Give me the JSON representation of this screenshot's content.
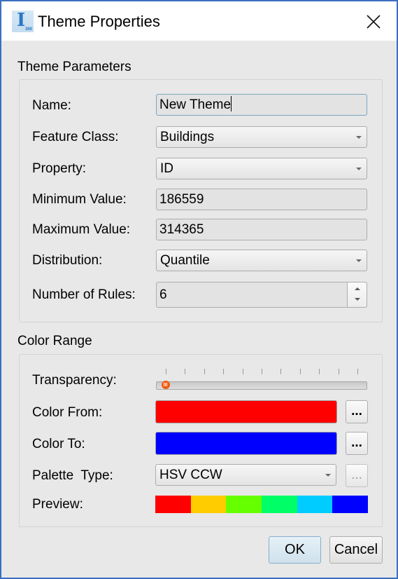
{
  "window": {
    "title": "Theme Properties",
    "app_icon": "app-logo-icon",
    "app_icon_letter": "I",
    "app_icon_sub": "360",
    "close_icon": "close-icon"
  },
  "theme_parameters": {
    "group_label": "Theme Parameters",
    "name": {
      "label": "Name:",
      "value": "New Theme"
    },
    "feature_class": {
      "label": "Feature Class:",
      "value": "Buildings"
    },
    "property": {
      "label": "Property:",
      "value": "ID"
    },
    "minimum_value": {
      "label": "Minimum Value:",
      "value": "186559"
    },
    "maximum_value": {
      "label": "Maximum Value:",
      "value": "314365"
    },
    "distribution": {
      "label": "Distribution:",
      "value": "Quantile"
    },
    "number_of_rules": {
      "label": "Number of Rules:",
      "value": "6"
    }
  },
  "color_range": {
    "group_label": "Color Range",
    "transparency": {
      "label": "Transparency:",
      "value_fraction": 0.0,
      "tick_count": 11
    },
    "color_from": {
      "label": "Color From:",
      "color": "#ff0000",
      "button_label": "..."
    },
    "color_to": {
      "label": "Color To:",
      "color": "#0000ff",
      "button_label": "..."
    },
    "palette_type": {
      "label": "Palette  Type:",
      "value": "HSV CCW",
      "button_label": "...",
      "button_enabled": false
    },
    "preview": {
      "label": "Preview:",
      "colors": [
        "#ff0000",
        "#ffcc00",
        "#66ff00",
        "#00ff66",
        "#00ccff",
        "#0000ff"
      ]
    }
  },
  "buttons": {
    "ok": "OK",
    "cancel": "Cancel"
  },
  "colors": {
    "window_border": "#3a6fc0",
    "slider_thumb": "#f25a12"
  }
}
